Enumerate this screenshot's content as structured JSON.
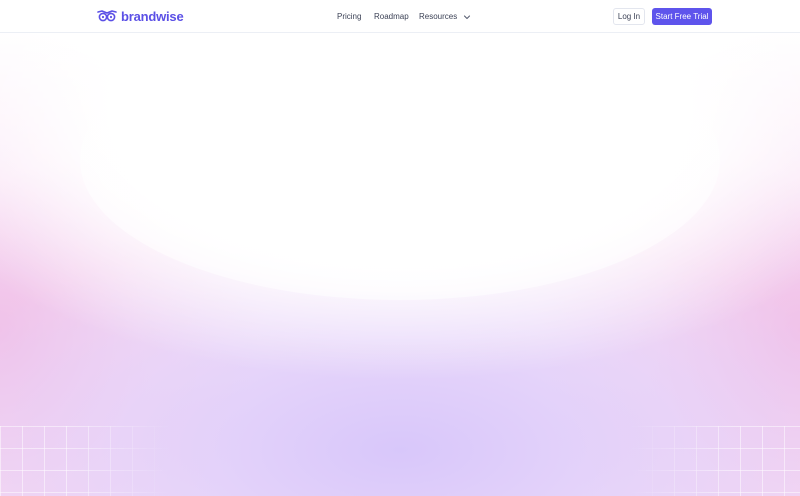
{
  "brand": {
    "name": "brandwise",
    "logo_icon": "owl-glasses-icon",
    "color": "#5b50e6"
  },
  "nav": {
    "pricing": "Pricing",
    "roadmap": "Roadmap",
    "resources": "Resources",
    "resources_icon": "chevron-down-icon"
  },
  "actions": {
    "login": "Log In",
    "trial": "Start Free Trial",
    "trial_color": "#5e54ec"
  },
  "background": {
    "glow_colors": [
      "#d6c4fa",
      "#eeb0e2"
    ]
  }
}
